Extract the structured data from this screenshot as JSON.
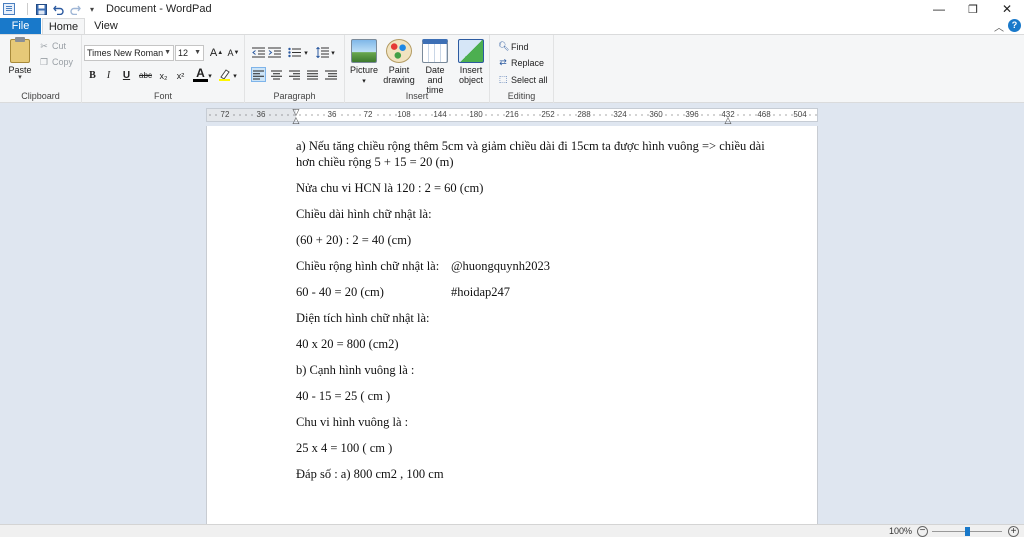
{
  "window": {
    "title": "Document - WordPad",
    "controls": {
      "minimize": "—",
      "restore": "❐",
      "close": "✕"
    }
  },
  "qat": {
    "save_icon": "save-icon",
    "undo_icon": "undo-icon",
    "redo_icon": "redo-icon",
    "customize_icon": "chevron-down-icon"
  },
  "tabs": [
    {
      "label": "File"
    },
    {
      "label": "Home"
    },
    {
      "label": "View"
    }
  ],
  "help": {
    "label": "?"
  },
  "ribbon": {
    "clipboard": {
      "label": "Clipboard",
      "paste": "Paste",
      "cut": "Cut",
      "copy": "Copy"
    },
    "font": {
      "label": "Font",
      "family": "Times New Roman",
      "size": "12",
      "bold": "B",
      "italic": "I",
      "underline": "U",
      "strikethrough": "abc",
      "subscript": "x₂",
      "superscript": "x²",
      "color": "A",
      "grow": "A",
      "shrink": "A"
    },
    "paragraph": {
      "label": "Paragraph"
    },
    "insert": {
      "label": "Insert",
      "picture": "Picture",
      "paint_drawing_1": "Paint",
      "paint_drawing_2": "drawing",
      "datetime_1": "Date and",
      "datetime_2": "time",
      "object_1": "Insert",
      "object_2": "object"
    },
    "editing": {
      "label": "Editing",
      "find": "Find",
      "replace": "Replace",
      "select_all": "Select all"
    }
  },
  "ruler": {
    "labels": [
      "72",
      "36",
      "36",
      "72",
      "108",
      "144",
      "180",
      "216",
      "252",
      "288",
      "324",
      "360",
      "396",
      "432",
      "468",
      "504"
    ]
  },
  "document": {
    "lines": {
      "a_line1": "a) Nếu tăng chiều rộng thêm 5cm và giảm chiều dài đi 15cm ta được hình vuông => chiều dài",
      "a_line2": "hơn chiều rộng 5 + 15 = 20 (m)",
      "half_perimeter": "Nửa chu vi HCN là 120 : 2 = 60 (cm)",
      "length_label": "Chiều dài hình chữ nhật là:",
      "length_calc": "(60 + 20) : 2 = 40 (cm)",
      "width_label": "Chiều rộng hình chữ nhật là:",
      "watermark_user": "@huongquynh2023",
      "width_calc": "60 - 40 = 20 (cm)",
      "watermark_tag": "#hoidap247",
      "area_label": "Diện tích hình chữ nhật là:",
      "area_calc": "40 x 20 = 800 (cm2)",
      "b_side_label": "b) Cạnh hình vuông là :",
      "side_calc": "40 - 15 = 25 ( cm )",
      "perimeter_label": "Chu vi hình vuông là :",
      "perimeter_calc": "25 x 4 = 100 ( cm )",
      "answer": "Đáp số : a) 800 cm2 , 100 cm"
    }
  },
  "status": {
    "zoom": "100%",
    "zoom_fraction": 0.5
  }
}
